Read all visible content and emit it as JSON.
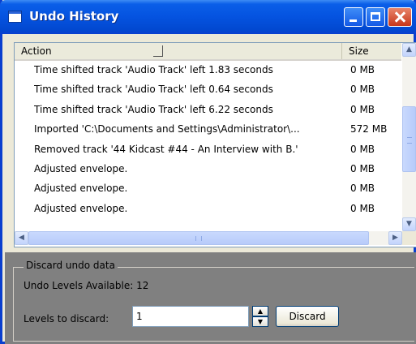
{
  "window": {
    "title": "Undo History"
  },
  "list": {
    "columns": {
      "action": "Action",
      "size": "Size"
    },
    "rows": [
      {
        "action": "Time shifted track 'Audio Track' left 1.83 seconds",
        "size": "0 MB"
      },
      {
        "action": "Time shifted track 'Audio Track' left 0.64 seconds",
        "size": "0 MB"
      },
      {
        "action": "Time shifted track 'Audio Track' left 6.22 seconds",
        "size": "0 MB"
      },
      {
        "action": "Imported 'C:\\Documents and Settings\\Administrator\\...",
        "size": "572 MB"
      },
      {
        "action": "Removed track '44 Kidcast #44 - An Interview with B.'",
        "size": "0 MB"
      },
      {
        "action": "Adjusted envelope.",
        "size": "0 MB"
      },
      {
        "action": "Adjusted envelope.",
        "size": "0 MB"
      },
      {
        "action": "Adjusted envelope.",
        "size": "0 MB"
      }
    ]
  },
  "discard": {
    "group_label": "Discard undo data",
    "levels_available": "Undo Levels Available: 12",
    "levels_label": "Levels to discard:",
    "levels_value": "1",
    "button_label": "Discard"
  },
  "colors": {
    "titlebar": "#0553e0",
    "panel": "#808080",
    "list_border": "#7f9db9"
  },
  "icons": [
    "app-window-icon",
    "minimize-icon",
    "maximize-icon",
    "close-icon",
    "scroll-up-icon",
    "scroll-down-icon",
    "scroll-left-icon",
    "scroll-right-icon",
    "spin-up-icon",
    "spin-down-icon"
  ]
}
